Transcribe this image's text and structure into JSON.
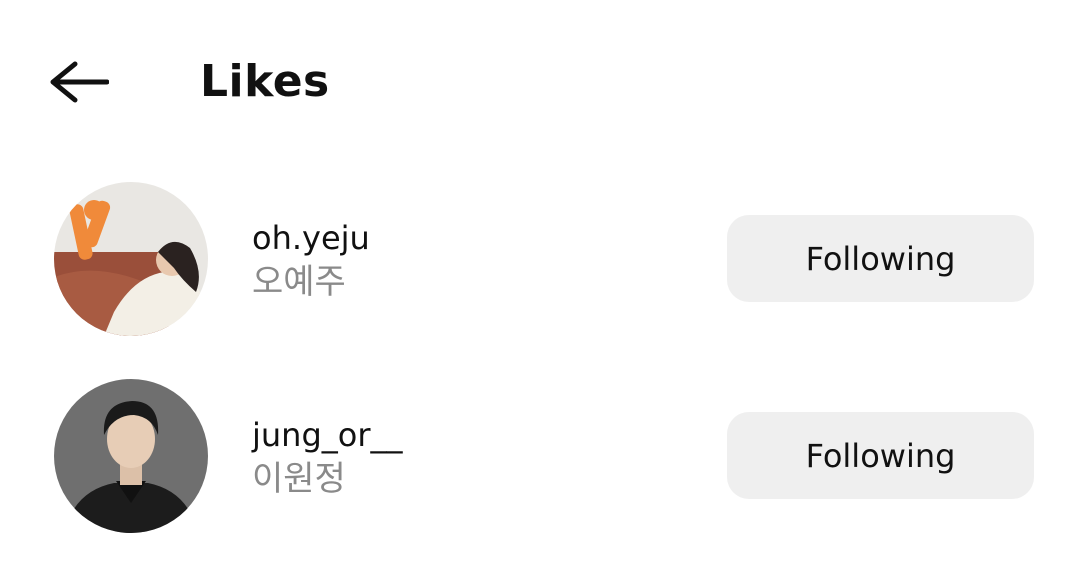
{
  "header": {
    "back_icon": "arrow-left-icon",
    "title": "Likes"
  },
  "users": [
    {
      "username": "oh.yeju",
      "full_name": "오예주",
      "follow_label": "Following"
    },
    {
      "username": "jung_or__",
      "full_name": "이원정",
      "follow_label": "Following"
    }
  ],
  "colors": {
    "button_bg": "#efefef",
    "secondary_text": "#8a8a8a",
    "primary_text": "#111111"
  }
}
